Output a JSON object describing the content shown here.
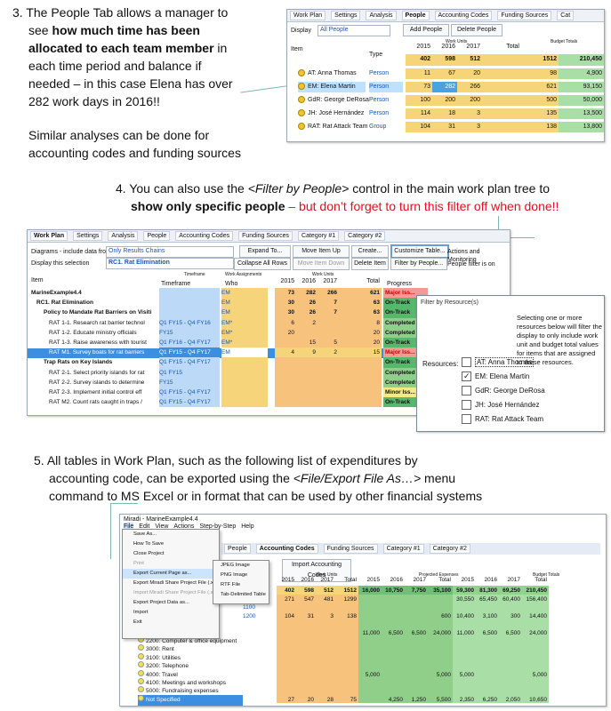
{
  "step3": {
    "number": "3.",
    "line1": "The People Tab allows a manager to",
    "line2a": "see ",
    "line2b": "how much time has been",
    "line3": "allocated to each team member",
    "line3b": " in",
    "line4": "each time period and balance if",
    "line5": "needed – in this case Elena has over",
    "line6": "282 work days in 2016!!",
    "para2a": "Similar analyses can be done for",
    "para2b": "accounting codes and funding sources"
  },
  "step4": {
    "number": "4.",
    "line1a": "You can also use the ",
    "line1b": "<Filter by People>",
    "line1c": " control in the main work plan tree to",
    "line2a": "show only specific people",
    "line2b": " – but don’t  forget to turn this filter off when done!!"
  },
  "step5": {
    "number": "5.",
    "line1": "All tables in Work Plan, such as the following list of expenditures by",
    "line2a": "accounting code, can be exported using the ",
    "line2b": "<File/Export File As…>",
    "line2c": " menu",
    "line3": "command to MS Excel or in format that can be used by other financial systems"
  },
  "shot1": {
    "tabs": [
      "Work Plan",
      "Settings",
      "Analysis",
      "People",
      "Accounting Codes",
      "Funding Sources",
      "Cat"
    ],
    "display_label": "Display",
    "display_value": "All People",
    "add_button": "Add People",
    "delete_button": "Delete People",
    "item_header": "Item",
    "type_header": "Type",
    "work_units_header": "Work Units",
    "budget_header": "Budget Totals",
    "years": [
      "2015",
      "2016",
      "2017",
      "Total"
    ],
    "total_row": [
      "402",
      "598",
      "512",
      "1512",
      "210,450"
    ],
    "people": [
      {
        "name": "AT: Anna Thomas",
        "type": "Person",
        "v": [
          "11",
          "67",
          "20",
          "98",
          "4,900"
        ]
      },
      {
        "name": "EM: Elena Martin",
        "type": "Person",
        "v": [
          "73",
          "282",
          "266",
          "621",
          "93,150"
        ]
      },
      {
        "name": "GdR: George DeRosa",
        "type": "Person",
        "v": [
          "100",
          "200",
          "200",
          "500",
          "50,000"
        ]
      },
      {
        "name": "JH: José Hernández",
        "type": "Person",
        "v": [
          "114",
          "18",
          "3",
          "135",
          "13,500"
        ]
      },
      {
        "name": "RAT: Rat Attack Team",
        "type": "Group",
        "v": [
          "104",
          "31",
          "3",
          "138",
          "13,800"
        ]
      }
    ]
  },
  "shot2": {
    "tabs": [
      "Work Plan",
      "Settings",
      "Analysis",
      "People",
      "Accounting Codes",
      "Funding Sources",
      "Category #1",
      "Category #2"
    ],
    "diagrams_label": "Diagrams - include data from",
    "diagrams_value": "Only Results Chains",
    "display_label": "Display this selection",
    "display_value": "RC1. Rat Elimination",
    "expand_button": "Expand To...",
    "move_up_button": "Move Item Up",
    "create_button": "Create...",
    "customize_button": "Customize Table...",
    "actions_label": "Actions and Monitoring",
    "collapse_button": "Collapse All Rows",
    "move_down_button": "Move Item Down",
    "delete_button": "Delete Item",
    "filter_button": "Filter by People...",
    "filter_status": "People filter is on",
    "item_header": "Item",
    "timeframe_header": "Timeframe",
    "who_header": "Who",
    "assign_header": "Work Assignments",
    "work_units_header": "Work Units",
    "progress_header": "Progress",
    "years": [
      "2015",
      "2016",
      "2017",
      "Total"
    ],
    "rows": [
      {
        "label": "MarineExample4.4",
        "tf": "",
        "who": "EM",
        "v": [
          "73",
          "282",
          "266",
          "621"
        ],
        "p": "Major Iss..."
      },
      {
        "label": "RC1. Rat Elimination",
        "tf": "",
        "who": "EM",
        "v": [
          "30",
          "26",
          "7",
          "63"
        ],
        "p": "On-Track"
      },
      {
        "label": "Policy to Mandate Rat Barriers on Visiti",
        "tf": "",
        "who": "EM",
        "v": [
          "30",
          "26",
          "7",
          "63"
        ],
        "p": "On-Track"
      },
      {
        "label": "RAT 1-1. Research rat barrier technol",
        "tf": "Q1 FY15 - Q4 FY16",
        "who": "EM*",
        "v": [
          "6",
          "2",
          "",
          "8"
        ],
        "p": "Completed"
      },
      {
        "label": "RAT 1-2. Educate ministry officials",
        "tf": "FY15",
        "who": "EM*",
        "v": [
          "20",
          "",
          "",
          "20"
        ],
        "p": "Completed"
      },
      {
        "label": "RAT 1-3. Raise awareness with tourist",
        "tf": "Q1 FY16 - Q4 FY17",
        "who": "EM*",
        "v": [
          "",
          "15",
          "5",
          "20"
        ],
        "p": "On-Track"
      },
      {
        "label": "RAT M1. Survey boats for rat barriers",
        "tf": "Q1 FY15 - Q4 FY17",
        "who": "EM",
        "v": [
          "4",
          "9",
          "2",
          "15"
        ],
        "p": "Major Iss..."
      },
      {
        "label": "Trap Rats on Key Islands",
        "tf": "Q1 FY15 - Q4 FY17",
        "who": "",
        "v": [
          "",
          "",
          "",
          ""
        ],
        "p": "On-Track"
      },
      {
        "label": "RAT 2-1. Select priority islands for rat",
        "tf": "Q1 FY15",
        "who": "",
        "v": [
          "",
          "",
          "",
          ""
        ],
        "p": "Completed"
      },
      {
        "label": "RAT 2-2. Survey islands to determine",
        "tf": "FY15",
        "who": "",
        "v": [
          "",
          "",
          "",
          ""
        ],
        "p": "Completed"
      },
      {
        "label": "RAT 2-3. Implement initial control eff",
        "tf": "Q1 FY15 - Q4 FY17",
        "who": "",
        "v": [
          "",
          "",
          "",
          ""
        ],
        "p": "Minor Iss..."
      },
      {
        "label": "RAT M2. Count rats caught in traps /",
        "tf": "Q1 FY15 - Q4 FY17",
        "who": "",
        "v": [
          "",
          "",
          "",
          ""
        ],
        "p": "On-Track"
      }
    ]
  },
  "dialog": {
    "title": "Filter by Resource(s)",
    "description": "Selecting one or more resources below will filter the display to only include work unit and budget total values for items that are assigned to these resources.",
    "resources_label": "Resources:",
    "resources": [
      {
        "name": "AT: Anna Thomas",
        "checked": false
      },
      {
        "name": "EM: Elena Martin",
        "checked": true
      },
      {
        "name": "GdR: George DeRosa",
        "checked": false
      },
      {
        "name": "JH: José Hernández",
        "checked": false
      },
      {
        "name": "RAT: Rat Attack Team",
        "checked": false
      }
    ]
  },
  "shot3": {
    "title": "Miradi - MarineExample4.4",
    "menubar": [
      "File",
      "Edit",
      "View",
      "Actions",
      "Step-by-Step",
      "Help"
    ],
    "tabs": [
      "People",
      "Accounting Codes",
      "Funding Sources",
      "Category #1",
      "Category #2"
    ],
    "file_menu": [
      "Save As...",
      "How To Save",
      "Close Project",
      "Print",
      "Export Current Page as...",
      "Export Miradi Share Project File (.xmpz2)",
      "Import Miradi Share Project File (.xmpz2)",
      "Export Project Data as...",
      "Import",
      "Exit"
    ],
    "export_submenu": [
      "JPEG Image",
      "PNG Image",
      "RTF File",
      "Tab-Delimited Table"
    ],
    "import_button": "Import Accounting Codes",
    "work_units_header": "Work Units",
    "projected_header": "Projected Expenses",
    "budget_header": "Budget Totals",
    "years": [
      "2015",
      "2016",
      "2017",
      "Total",
      "2015",
      "2016",
      "2017",
      "Total",
      "2015",
      "2016",
      "2017",
      "Total"
    ],
    "total_row": [
      "402",
      "598",
      "512",
      "1512",
      "16,000",
      "10,750",
      "7,750",
      "35,100",
      "59,300",
      "81,300",
      "69,250",
      "210,450"
    ],
    "rows": [
      {
        "code": "1000",
        "label": "",
        "v": [
          "271",
          "547",
          "481",
          "1299",
          "",
          "",
          "",
          "",
          "30,550",
          "65,450",
          "60,400",
          "156,400"
        ]
      },
      {
        "code": "1100",
        "label": "",
        "v": [
          "",
          "",
          "",
          "",
          "",
          "",
          "",
          "",
          "",
          "",
          "",
          ""
        ]
      },
      {
        "code": "1200",
        "label": "1200: Other Wages",
        "v": [
          "104",
          "31",
          "3",
          "138",
          "",
          "",
          "",
          "600",
          "10,400",
          "3,100",
          "300",
          "14,400"
        ]
      },
      {
        "code": "",
        "label": "2000: Equipment",
        "v": [
          "",
          "",
          "",
          "",
          "",
          "",
          "",
          "",
          "",
          "",
          "",
          ""
        ]
      },
      {
        "code": "",
        "label": "2100: Field equipment",
        "v": [
          "",
          "",
          "",
          "",
          "11,000",
          "6,500",
          "6,500",
          "24,000",
          "11,000",
          "6,500",
          "6,500",
          "24,000"
        ]
      },
      {
        "code": "",
        "label": "2200: Computer & office equipment",
        "v": [
          "",
          "",
          "",
          "",
          "",
          "",
          "",
          "",
          "",
          "",
          "",
          ""
        ]
      },
      {
        "code": "",
        "label": "3000: Rent",
        "v": [
          "",
          "",
          "",
          "",
          "",
          "",
          "",
          "",
          "",
          "",
          "",
          ""
        ]
      },
      {
        "code": "",
        "label": "3100: Utilities",
        "v": [
          "",
          "",
          "",
          "",
          "",
          "",
          "",
          "",
          "",
          "",
          "",
          ""
        ]
      },
      {
        "code": "",
        "label": "3200: Telephone",
        "v": [
          "",
          "",
          "",
          "",
          "",
          "",
          "",
          "",
          "",
          "",
          "",
          ""
        ]
      },
      {
        "code": "",
        "label": "4000: Travel",
        "v": [
          "",
          "",
          "",
          "",
          "5,000",
          "",
          "",
          "5,000",
          "5,000",
          "",
          "",
          "5,000"
        ]
      },
      {
        "code": "",
        "label": "4100: Meetings and workshops",
        "v": [
          "",
          "",
          "",
          "",
          "",
          "",
          "",
          "",
          "",
          "",
          "",
          ""
        ]
      },
      {
        "code": "",
        "label": "5000: Fundraising expenses",
        "v": [
          "",
          "",
          "",
          "",
          "",
          "",
          "",
          "",
          "",
          "",
          "",
          ""
        ]
      },
      {
        "code": "",
        "label": "Not Specified",
        "v": [
          "27",
          "20",
          "28",
          "75",
          "",
          "4,250",
          "1,250",
          "5,500",
          "2,350",
          "6,250",
          "2,050",
          "10,650"
        ]
      }
    ]
  }
}
